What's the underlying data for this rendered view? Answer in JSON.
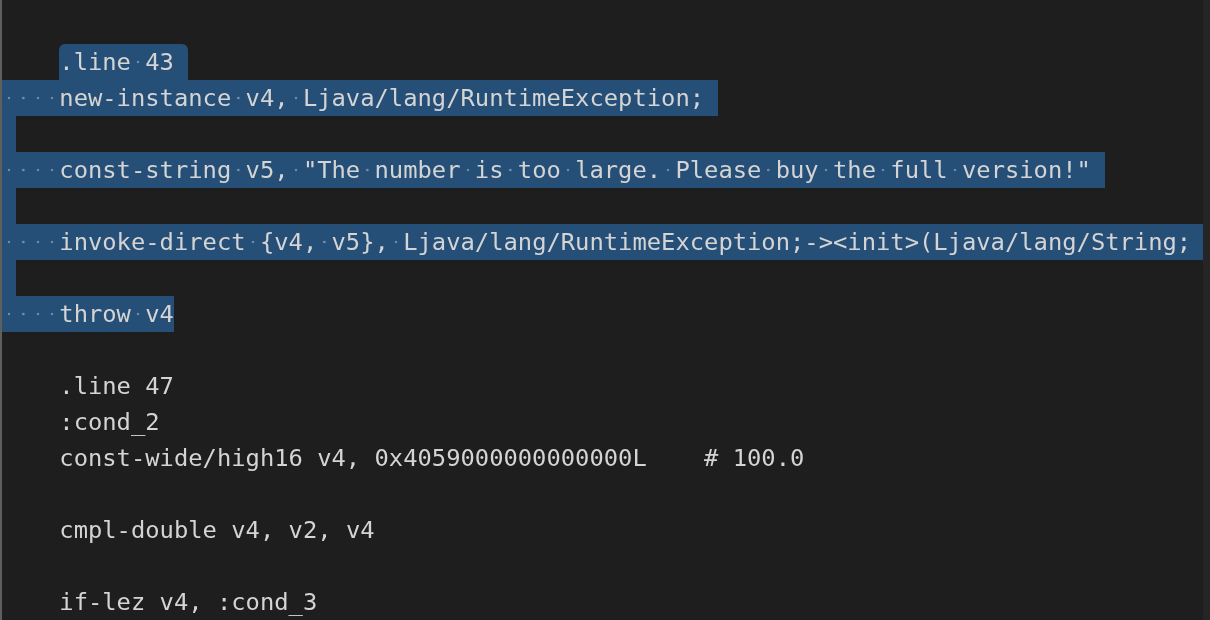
{
  "editor": {
    "lines": [
      {
        "kind": "code",
        "text": "    .line 43",
        "selected": true,
        "indent_selected": false
      },
      {
        "kind": "code",
        "text": "    new-instance v4, Ljava/lang/RuntimeException;",
        "selected": true,
        "indent_selected": true
      },
      {
        "kind": "blank",
        "selected": true
      },
      {
        "kind": "code",
        "text": "    const-string v5, \"The number is too large. Please buy the full version!\"",
        "selected": true,
        "indent_selected": true
      },
      {
        "kind": "blank",
        "selected": true
      },
      {
        "kind": "code",
        "text": "    invoke-direct {v4, v5}, Ljava/lang/RuntimeException;-><init>(Ljava/lang/String;",
        "selected": true,
        "indent_selected": true
      },
      {
        "kind": "blank",
        "selected": true
      },
      {
        "kind": "code",
        "text": "    throw v4",
        "selected": true,
        "indent_selected": true
      },
      {
        "kind": "blank"
      },
      {
        "kind": "code",
        "text": "    .line 47",
        "selected": false
      },
      {
        "kind": "code",
        "text": "    :cond_2",
        "selected": false
      },
      {
        "kind": "code",
        "text": "    const-wide/high16 v4, 0x4059000000000000L    # 100.0",
        "selected": false
      },
      {
        "kind": "blank"
      },
      {
        "kind": "code",
        "text": "    cmpl-double v4, v2, v4",
        "selected": false
      },
      {
        "kind": "blank"
      },
      {
        "kind": "code",
        "text": "    if-lez v4, :cond_3",
        "selected": false
      }
    ]
  }
}
